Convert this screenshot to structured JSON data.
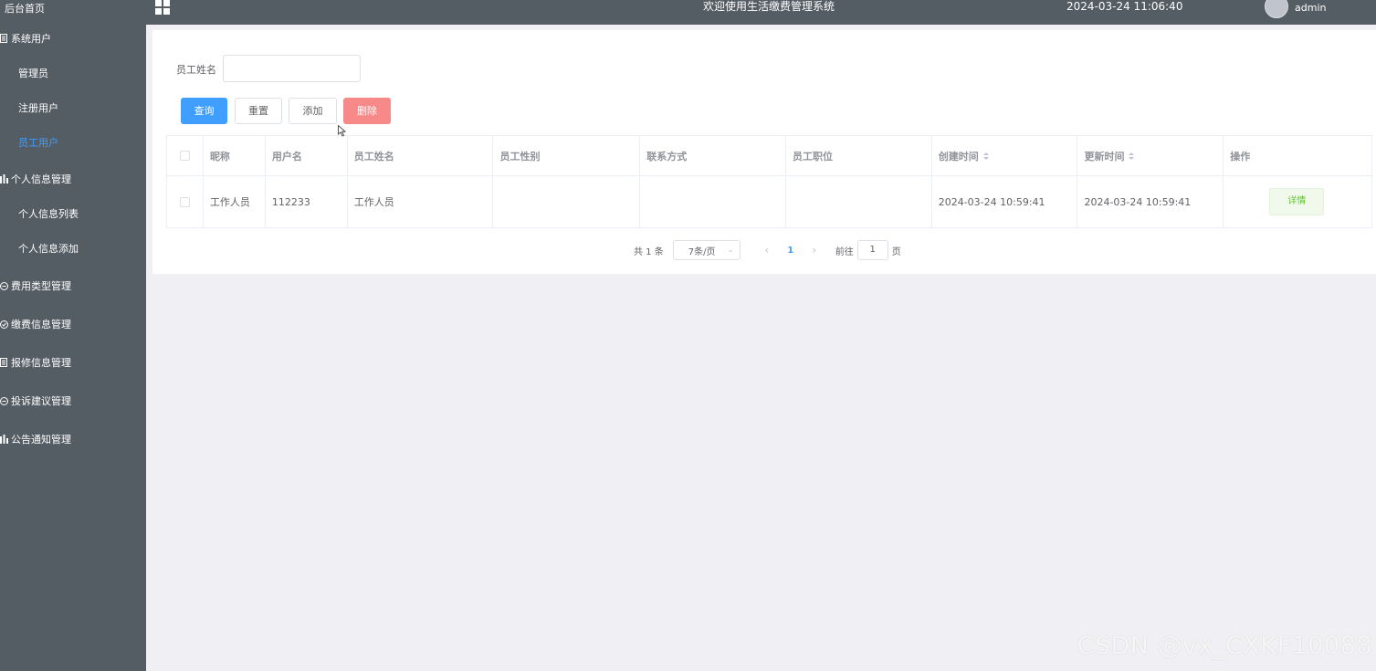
{
  "sidebar": {
    "home": "后台首页",
    "groups": [
      {
        "label": "系统用户",
        "icon": "doc-icon",
        "children": [
          "管理员",
          "注册用户",
          "员工用户"
        ],
        "active_child": 2
      },
      {
        "label": "个人信息管理",
        "icon": "chart-icon",
        "children": [
          "个人信息列表",
          "个人信息添加"
        ]
      },
      {
        "label": "费用类型管理",
        "icon": "message-icon"
      },
      {
        "label": "缴费信息管理",
        "icon": "check-circle-icon"
      },
      {
        "label": "报修信息管理",
        "icon": "doc-icon"
      },
      {
        "label": "投诉建议管理",
        "icon": "message-icon"
      },
      {
        "label": "公告通知管理",
        "icon": "chart-icon"
      }
    ]
  },
  "header": {
    "title": "欢迎使用生活缴费管理系统",
    "datetime": "2024-03-24 11:06:40",
    "user": "admin"
  },
  "filter": {
    "label": "员工姓名",
    "value": "",
    "placeholder": ""
  },
  "buttons": {
    "query": "查询",
    "reset": "重置",
    "add": "添加",
    "delete": "删除"
  },
  "table": {
    "headers": [
      "昵称",
      "用户名",
      "员工姓名",
      "员工性别",
      "联系方式",
      "员工职位",
      "创建时间",
      "更新时间",
      "操作"
    ],
    "rows": [
      {
        "nickname": "工作人员",
        "username": "112233",
        "name": "工作人员",
        "gender": "",
        "phone": "",
        "position": "",
        "created": "2024-03-24 10:59:41",
        "updated": "2024-03-24 10:59:41",
        "action": "详情"
      }
    ]
  },
  "pagination": {
    "total": "共 1 条",
    "page_size": "7条/页",
    "current": "1",
    "goto_label": "前往",
    "goto_value": "1",
    "page_suffix": "页"
  },
  "watermark": "CSDN @vx_CXKF10088",
  "colors": {
    "sidebar_bg": "#545c64",
    "primary": "#409eff",
    "danger": "#f78989",
    "success": "#67c23a"
  }
}
